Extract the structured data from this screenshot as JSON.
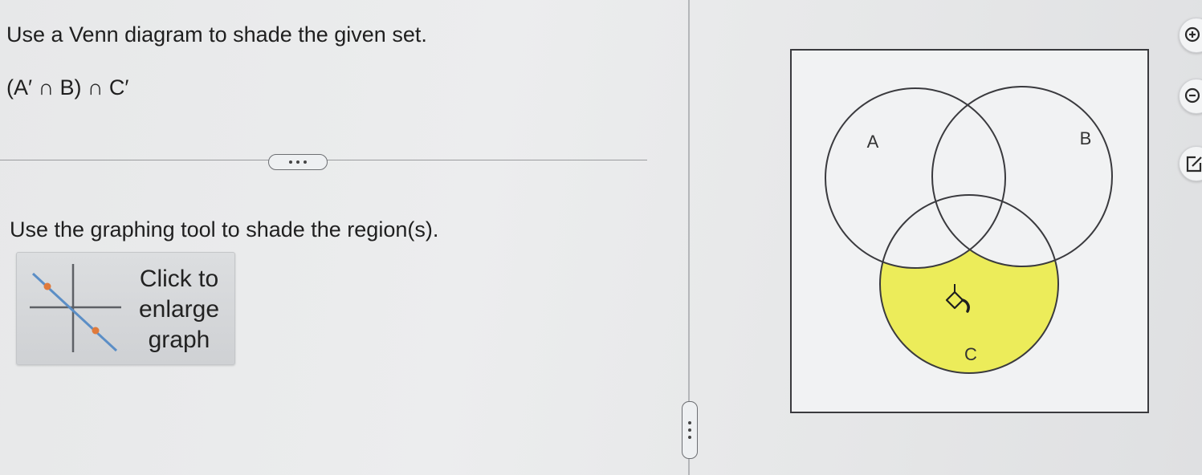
{
  "question": {
    "title": "Use a Venn diagram to shade the given set.",
    "expression": "(A′ ∩ B) ∩ C′",
    "instruction": "Use the graphing tool to shade the region(s)."
  },
  "enlarge_button": {
    "label": "Click to enlarge graph",
    "icon": "graph-icon"
  },
  "venn": {
    "sets": [
      "A",
      "B",
      "C"
    ],
    "shaded_region": "C ∖ (A ∪ B)",
    "shade_color": "#ecec5a",
    "outline_color": "#3a3a3e",
    "cursor_icon": "paint-bucket-icon"
  },
  "toolbar": {
    "zoom_in_icon": "zoom-in-icon",
    "zoom_out_icon": "zoom-out-icon",
    "popout_icon": "popout-icon"
  }
}
